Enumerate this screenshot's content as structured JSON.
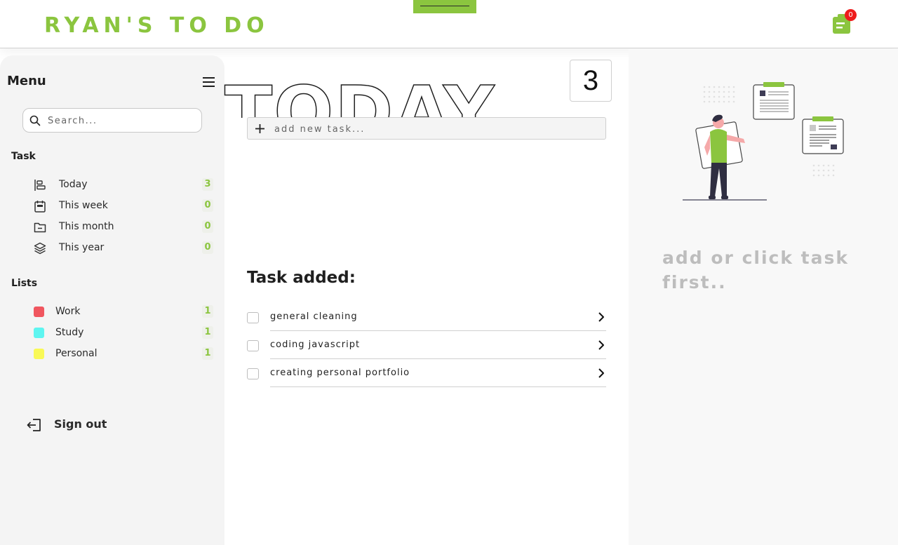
{
  "header": {
    "logo": "RYAN'S TO DO",
    "notification_count": "0"
  },
  "colors": {
    "accent": "#8bc53f",
    "badge": "#ee1c1c",
    "work": "#f0565f",
    "study": "#5ef5f0",
    "personal": "#f9f956"
  },
  "sidebar": {
    "title": "Menu",
    "search_placeholder": "Search...",
    "task_section": "Task",
    "task_items": [
      {
        "label": "Today",
        "count": "3",
        "icon": "today-icon"
      },
      {
        "label": "This week",
        "count": "0",
        "icon": "calendar-icon"
      },
      {
        "label": "This month",
        "count": "0",
        "icon": "folder-icon"
      },
      {
        "label": "This year",
        "count": "0",
        "icon": "layers-icon"
      }
    ],
    "lists_section": "Lists",
    "list_items": [
      {
        "label": "Work",
        "count": "1"
      },
      {
        "label": "Study",
        "count": "1"
      },
      {
        "label": "Personal",
        "count": "1"
      }
    ],
    "signout": "Sign out"
  },
  "main": {
    "title": "TODAY",
    "task_count": "3",
    "add_placeholder": "add new task...",
    "tasks_heading": "Task added:",
    "tasks": [
      {
        "text": "general cleaning"
      },
      {
        "text": "coding javascript"
      },
      {
        "text": "creating personal portfolio"
      }
    ]
  },
  "detail": {
    "empty_message": "add or click task first.."
  }
}
